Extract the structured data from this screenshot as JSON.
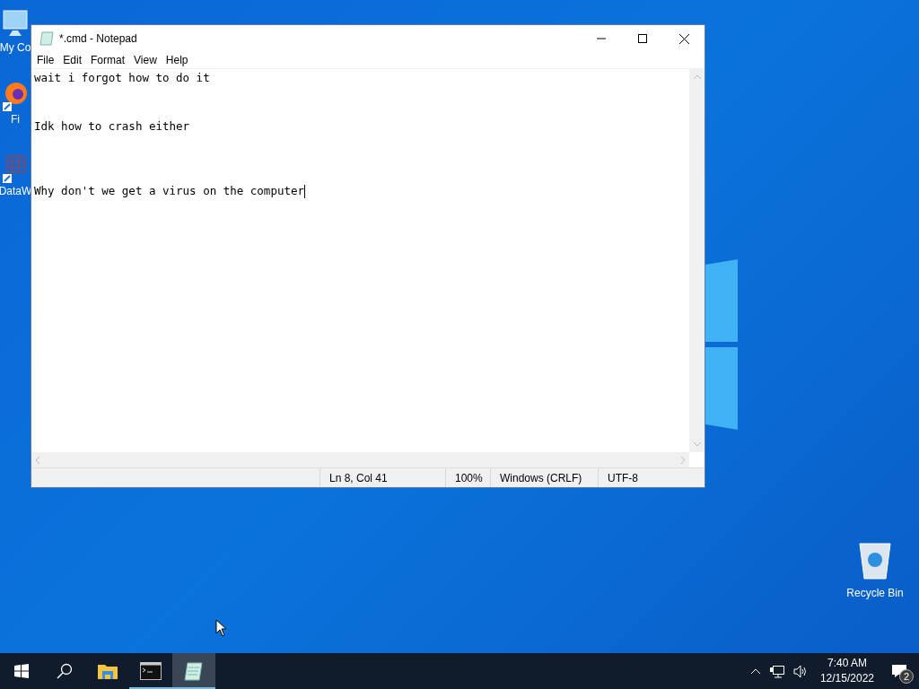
{
  "desktop_icons": [
    {
      "label": "My Co",
      "kind": "computer"
    },
    {
      "label": "Fi",
      "kind": "browser"
    },
    {
      "label": "DataW",
      "kind": "app"
    }
  ],
  "recycle_bin": {
    "label": "Recycle Bin"
  },
  "notepad": {
    "title": "*.cmd - Notepad",
    "menu": [
      "File",
      "Edit",
      "Format",
      "View",
      "Help"
    ],
    "text": "wait i forgot how to do it\n\n\nIdk how to crash either\n\n\n\nWhy don't we get a virus on the computer",
    "status": [
      "Ln 8, Col 41",
      "100%",
      "Windows (CRLF)",
      "UTF-8"
    ]
  },
  "taskbar": {
    "apps": [
      {
        "kind": "explorer",
        "running": false,
        "selected": false
      },
      {
        "kind": "terminal",
        "running": true,
        "selected": false
      },
      {
        "kind": "notepad",
        "running": true,
        "selected": true
      }
    ],
    "time": "7:40 AM",
    "date": "12/15/2022",
    "notifications": "2"
  }
}
